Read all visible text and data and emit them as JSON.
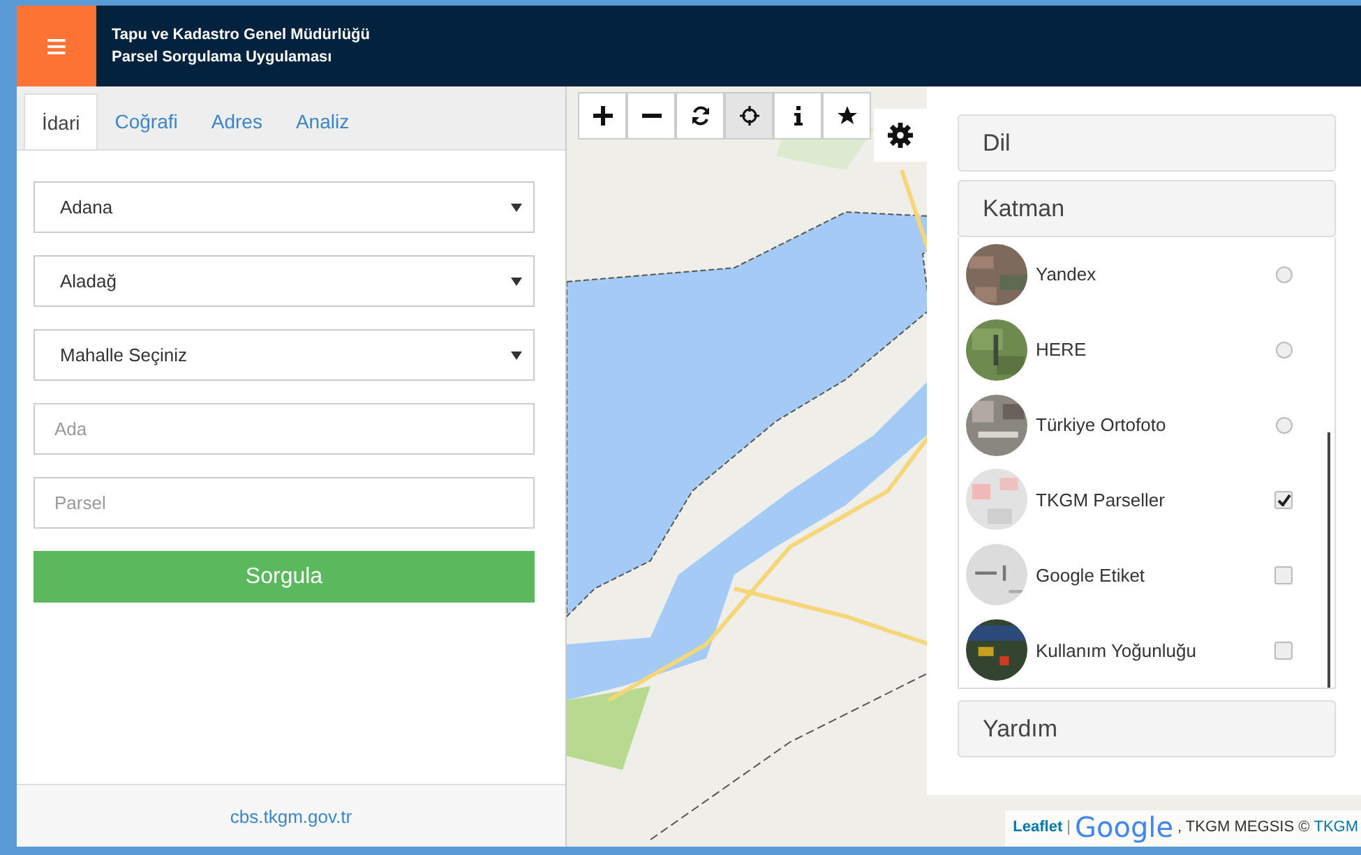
{
  "header": {
    "menu_icon": "≡",
    "title": "Tapu ve Kadastro Genel Müdürlüğü",
    "subtitle": "Parsel Sorgulama Uygulaması"
  },
  "tabs": [
    {
      "label": "İdari",
      "selected": true
    },
    {
      "label": "Coğrafi",
      "selected": false
    },
    {
      "label": "Adres",
      "selected": false
    },
    {
      "label": "Analiz",
      "selected": false
    }
  ],
  "form": {
    "selects": [
      {
        "value": "Adana"
      },
      {
        "value": "Aladağ"
      },
      {
        "value": "Mahalle Seçiniz"
      }
    ],
    "inputs": [
      {
        "placeholder": "Ada"
      },
      {
        "placeholder": "Parsel"
      }
    ],
    "submit": "Sorgula"
  },
  "footer_link": "cbs.tkgm.gov.tr",
  "map": {
    "kind": "picture",
    "tools": [
      {
        "kind": "plus",
        "selected": false
      },
      {
        "kind": "minus",
        "selected": false
      },
      {
        "kind": "refresh",
        "selected": false
      },
      {
        "kind": "locate",
        "selected": true
      },
      {
        "kind": "info",
        "selected": false
      },
      {
        "kind": "star",
        "selected": false
      }
    ],
    "attribution": {
      "leaflet": "Leaflet",
      "separator": "|",
      "google": "Google",
      "rest": ", TKGM MEGSIS ©",
      "tkgm": "TKGM"
    }
  },
  "panel": {
    "sections": [
      {
        "title": "Dil"
      },
      {
        "title": "Katman"
      }
    ],
    "layers": [
      {
        "name": "Yandex",
        "kind": "radio",
        "selected": false
      },
      {
        "name": "HERE",
        "kind": "radio",
        "selected": false
      },
      {
        "name": "Türkiye Ortofoto",
        "kind": "radio",
        "selected": false
      },
      {
        "name": "TKGM Parseller",
        "kind": "checkbox",
        "checked": true
      },
      {
        "name": "Google Etiket",
        "kind": "checkbox",
        "checked": false
      },
      {
        "name": "Kullanım Yoğunluğu",
        "kind": "checkbox",
        "checked": false
      }
    ],
    "footer_section": {
      "title": "Yardım"
    }
  }
}
